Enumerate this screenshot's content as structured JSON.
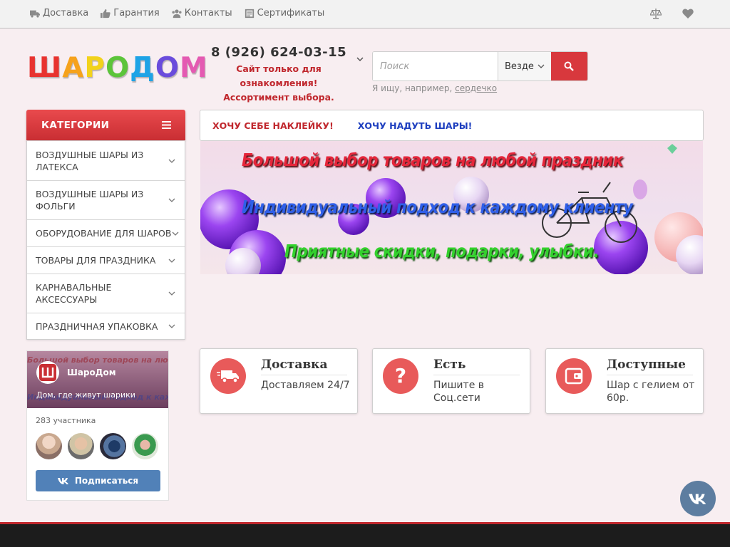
{
  "topbar": {
    "links": [
      {
        "label": "Доставка",
        "icon": "truck-icon"
      },
      {
        "label": "Гарантия",
        "icon": "thumbs-up-icon"
      },
      {
        "label": "Контакты",
        "icon": "users-icon"
      },
      {
        "label": "Сертификаты",
        "icon": "certificate-icon"
      }
    ],
    "right_icons": [
      "scales-icon",
      "heart-icon"
    ]
  },
  "header": {
    "logo_letters": [
      "Ш",
      "А",
      "Р",
      "О",
      "Д",
      "О",
      "М"
    ],
    "logo_colors": [
      "#e8332f",
      "#f6a21c",
      "#f2d21c",
      "#5cc43a",
      "#1ea3e6",
      "#6a4cdc",
      "#e45ab2"
    ],
    "phone": "8 (926) 624-03-15",
    "note_line1": "Сайт только для ознакомления!",
    "note_line2": "Ассортимент выбора."
  },
  "search": {
    "placeholder": "Поиск",
    "scope": "Везде",
    "hint_prefix": "Я ищу, например,",
    "hint_example": "сердечко"
  },
  "categories": {
    "title": "КАТЕГОРИИ",
    "items": [
      "ВОЗДУШНЫЕ ШАРЫ ИЗ ЛАТЕКСА",
      "ВОЗДУШНЫЕ ШАРЫ ИЗ ФОЛЬГИ",
      "ОБОРУДОВАНИЕ ДЛЯ ШАРОВ",
      "ТОВАРЫ ДЛЯ ПРАЗДНИКА",
      "КАРНАВАЛЬНЫЕ АКСЕССУАРЫ",
      "ПРАЗДНИЧНАЯ УПАКОВКА"
    ]
  },
  "tabs": {
    "sticker": "ХОЧУ СЕБЕ НАКЛЕЙКУ!",
    "balloons": "ХОЧУ НАДУТЬ ШАРЫ!"
  },
  "banner": {
    "line1": "Большой выбор товаров на любой праздник",
    "line2": "Индивидуальный подход к каждому клиенту",
    "line3": "Приятные скидки, подарки, улыбки."
  },
  "features": [
    {
      "title": "Доставка",
      "text": "Доставляем 24/7",
      "icon": "truck-icon"
    },
    {
      "title": "Есть",
      "text": "Пишите в Соц.сети",
      "icon": "question-bubble-icon"
    },
    {
      "title": "Доступные",
      "text": "Шар с гелием от 60р.",
      "icon": "wallet-icon"
    }
  ],
  "vk_widget": {
    "group_name": "ШароДом",
    "tagline": "Дом, где живут шарики",
    "members": "283 участника",
    "subscribe": "Подписаться"
  },
  "colors": {
    "accent": "#d8383d",
    "vk": "#5181b8"
  }
}
